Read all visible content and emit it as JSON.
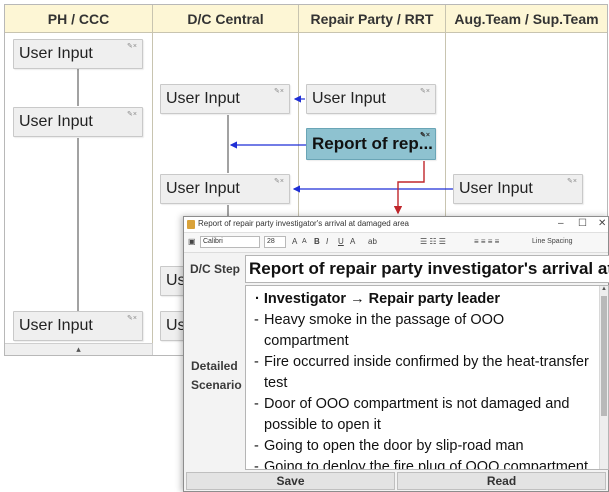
{
  "lanes": [
    {
      "name": "PH / CCC"
    },
    {
      "name": "D/C Central"
    },
    {
      "name": "Repair Party / RRT"
    },
    {
      "name": "Aug.Team / Sup.Team"
    }
  ],
  "nodes": {
    "ph_1": "User Input",
    "ph_2": "User Input",
    "ph_3": "User Input",
    "dc_1": "User Input",
    "dc_2": "User Input",
    "dc_3": "Us",
    "dc_4": "Us",
    "rp_1": "User Input",
    "rp_2": "Report of rep...",
    "aug_1": "User Input"
  },
  "node_icon": "edit-close-icon",
  "lane_footer_mark": "▴",
  "dialog": {
    "title": "Report of repair party investigator's arrival at damaged area",
    "window_controls": {
      "minimize": "–",
      "maximize": "☐",
      "close": "✕"
    },
    "toolbar": {
      "font": "Calibri",
      "size": "28",
      "grow": "A",
      "shrink": "A",
      "bold": "B",
      "italic": "I",
      "underline": "U",
      "fontcolor": "A",
      "highlight": "ab",
      "lists": "☰ ☷ ☰",
      "align": "≡ ≡ ≡ ≡",
      "line_spacing": "Line Spacing"
    },
    "step_label": "D/C Step",
    "step_value": "Report of repair party investigator's arrival at damaged area",
    "detail_label_1": "Detailed",
    "detail_label_2": "Scenario",
    "scenario": {
      "heading": "Investigator → Repair party leader",
      "lines": [
        "Heavy smoke in the passage of OOO compartment",
        "Fire occurred inside confirmed by the heat-transfer test",
        "Door of OOO compartment is not damaged and possible to open it",
        "Going to open the door by slip-road man",
        "Going to deploy the fire plug of OOO compartment"
      ]
    },
    "buttons": {
      "save": "Save",
      "read": "Read"
    }
  },
  "colors": {
    "lane_header": "#fdf6d5",
    "highlight_node": "#8ec2d0",
    "link_blue": "#1f2fd6",
    "link_red": "#c0262b"
  }
}
